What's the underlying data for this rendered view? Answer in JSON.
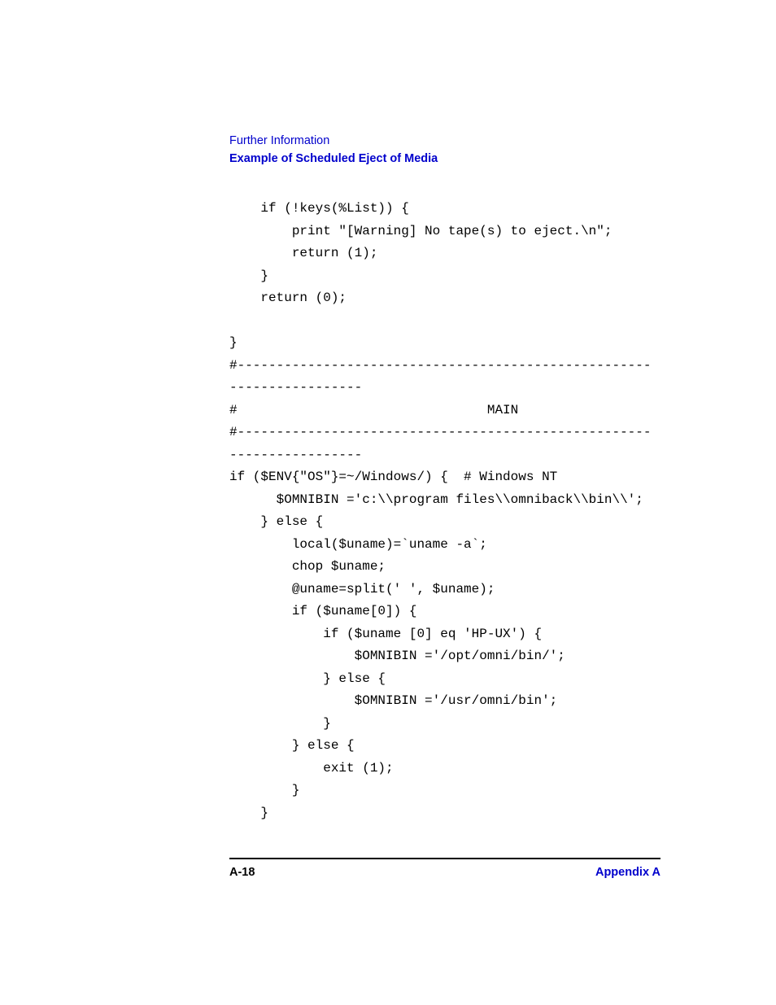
{
  "header": {
    "section": "Further Information",
    "subsection": "Example of Scheduled Eject of Media"
  },
  "code": {
    "lines": [
      "    if (!keys(%List)) {",
      "        print \"[Warning] No tape(s) to eject.\\n\";",
      "        return (1);",
      "    }",
      "    return (0);",
      "",
      "}",
      "#-----------------------------------------------------",
      "-----------------",
      "#                                MAIN",
      "#-----------------------------------------------------",
      "-----------------",
      "if ($ENV{\"OS\"}=~/Windows/) {  # Windows NT",
      "      $OMNIBIN ='c:\\\\program files\\\\omniback\\\\bin\\\\';",
      "    } else {",
      "        local($uname)=`uname -a`;",
      "        chop $uname;",
      "        @uname=split(' ', $uname);",
      "        if ($uname[0]) {",
      "            if ($uname [0] eq 'HP-UX') {",
      "                $OMNIBIN ='/opt/omni/bin/';",
      "            } else {",
      "                $OMNIBIN ='/usr/omni/bin';",
      "            }",
      "        } else {",
      "            exit (1);",
      "        }",
      "    }"
    ]
  },
  "footer": {
    "page": "A-18",
    "appendix": "Appendix A"
  }
}
